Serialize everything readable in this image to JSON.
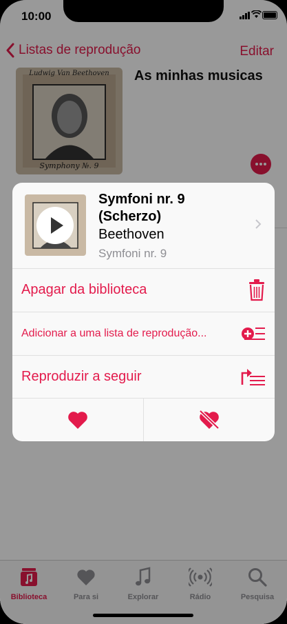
{
  "status": {
    "time": "10:00"
  },
  "nav": {
    "back_label": "Listas de reprodução",
    "edit_label": "Editar"
  },
  "playlist": {
    "title": "As minhas musicas",
    "cover_text_top": "Ludwig Van Beethoven",
    "cover_text_bottom": "Symphony №. 9"
  },
  "sheet": {
    "song_title": "Symfoni nr. 9 (Scherzo)",
    "artist": "Beethoven",
    "album": "Symfoni nr. 9",
    "actions": [
      {
        "label": "Apagar da biblioteca",
        "icon": "trash-icon"
      },
      {
        "label": "Adicionar a uma lista de reprodução...",
        "icon": "add-to-playlist-icon"
      },
      {
        "label": "Reproduzir a seguir",
        "icon": "play-next-icon"
      }
    ],
    "love_icon": "heart-icon",
    "dislike_icon": "broken-heart-icon"
  },
  "tabbar": {
    "items": [
      {
        "label": "Biblioteca",
        "icon": "library-icon",
        "active": true
      },
      {
        "label": "Para si",
        "icon": "heart-icon",
        "active": false
      },
      {
        "label": "Explorar",
        "icon": "music-note-icon",
        "active": false
      },
      {
        "label": "Rádio",
        "icon": "radio-icon",
        "active": false
      },
      {
        "label": "Pesquisa",
        "icon": "search-icon",
        "active": false
      }
    ]
  },
  "colors": {
    "accent": "#e31b4c",
    "dim_overlay": "rgba(0,0,0,0.4)",
    "inactive": "#8e8e93"
  }
}
